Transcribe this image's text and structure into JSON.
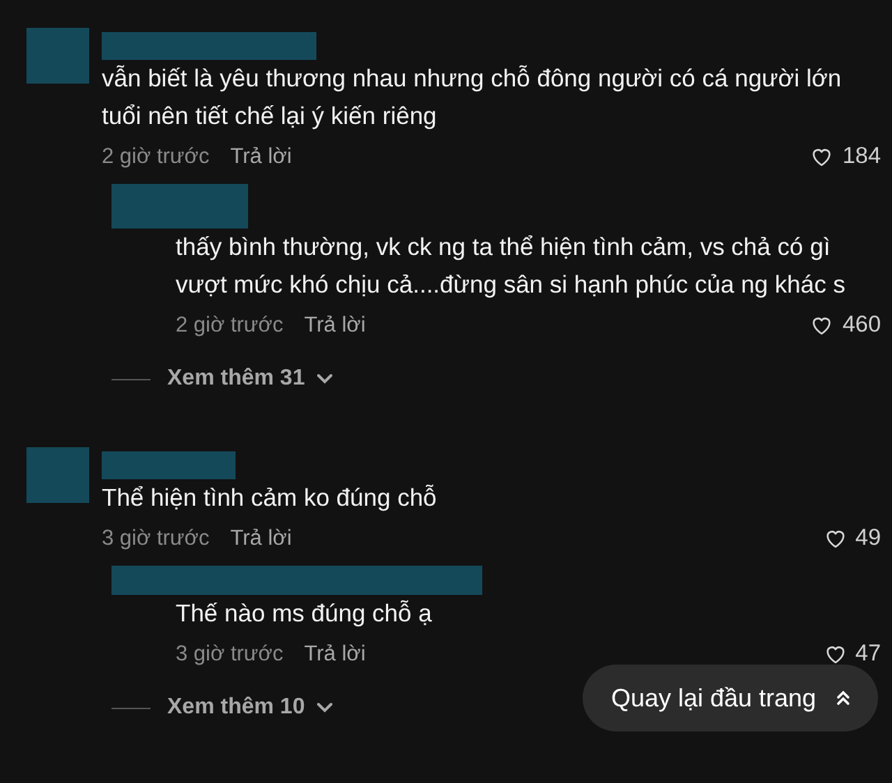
{
  "comments": [
    {
      "text": "vẫn biết là yêu thương nhau nhưng chỗ đông người có cá người lớn tuổi nên tiết chế lại ý kiến riêng",
      "time": "2 giờ trước",
      "reply_label": "Trả lời",
      "likes": "184",
      "replies": [
        {
          "text": "thấy bình thường, vk ck ng ta thể hiện tình cảm, vs chả có gì vượt mức khó chịu cả....đừng sân si hạnh phúc của ng khác s",
          "time": "2 giờ trước",
          "reply_label": "Trả lời",
          "likes": "460"
        }
      ],
      "more": "Xem thêm 31"
    },
    {
      "text": "Thể hiện tình cảm ko đúng chỗ",
      "time": "3 giờ trước",
      "reply_label": "Trả lời",
      "likes": "49",
      "replies": [
        {
          "text": "Thế nào ms đúng chỗ ạ",
          "time": "3 giờ trước",
          "reply_label": "Trả lời",
          "likes": "47"
        }
      ],
      "more": "Xem thêm 10"
    }
  ],
  "back_to_top": {
    "label": "Quay lại đầu trang"
  }
}
